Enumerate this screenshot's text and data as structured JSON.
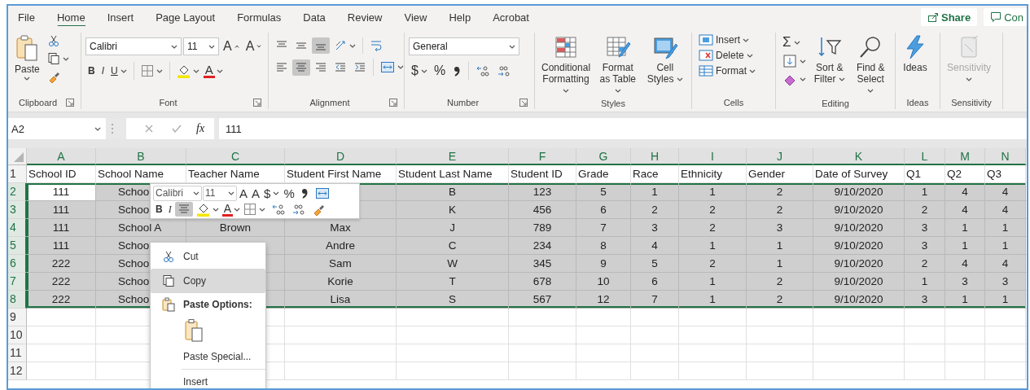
{
  "tabs": [
    {
      "label": "File",
      "selected": false
    },
    {
      "label": "Home",
      "selected": true
    },
    {
      "label": "Insert",
      "selected": false
    },
    {
      "label": "Page Layout",
      "selected": false
    },
    {
      "label": "Formulas",
      "selected": false
    },
    {
      "label": "Data",
      "selected": false
    },
    {
      "label": "Review",
      "selected": false
    },
    {
      "label": "View",
      "selected": false
    },
    {
      "label": "Help",
      "selected": false
    },
    {
      "label": "Acrobat",
      "selected": false
    }
  ],
  "share_button": "Share",
  "comments_button": "Con",
  "ribbon": {
    "clipboard": {
      "paste": "Paste",
      "label": "Clipboard"
    },
    "font": {
      "font_name": "Calibri",
      "font_size": "11",
      "grow": "A",
      "shrink": "A",
      "bold": "B",
      "italic": "I",
      "underline": "U",
      "font_color": "A",
      "label": "Font"
    },
    "alignment": {
      "buttons": [
        {
          "kind": "top",
          "selected": false
        },
        {
          "kind": "middle",
          "selected": false
        },
        {
          "kind": "bottom",
          "selected": true
        },
        {
          "kind": "left",
          "selected": false
        },
        {
          "kind": "center",
          "selected": true
        },
        {
          "kind": "right",
          "selected": false
        },
        {
          "kind": "outdent",
          "selected": false
        },
        {
          "kind": "indent",
          "selected": false
        }
      ],
      "label": "Alignment"
    },
    "number": {
      "format": "General",
      "currency": "$",
      "percent": "%",
      "label": "Number"
    },
    "styles": {
      "buttons": [
        "Conditional Formatting",
        "Format as Table",
        "Cell Styles"
      ],
      "label": "Styles"
    },
    "cells": {
      "buttons": [
        "Insert",
        "Delete",
        "Format"
      ],
      "label": "Cells"
    },
    "editing": {
      "autosum": "Σ",
      "buttons": [
        "Sort & Filter",
        "Find & Select"
      ],
      "label": "Editing"
    },
    "ideas": {
      "button": "Ideas",
      "label": "Ideas"
    },
    "sensitivity": {
      "button": "Sensitivity",
      "disabled": true,
      "label": "Sensitivity"
    }
  },
  "formula_bar": {
    "name_box": "A2",
    "function_label": "fx",
    "value": "111"
  },
  "sheet": {
    "columns": [
      {
        "letter": "A",
        "selected": true
      },
      {
        "letter": "B",
        "selected": true
      },
      {
        "letter": "C",
        "selected": true
      },
      {
        "letter": "D",
        "selected": true
      },
      {
        "letter": "E",
        "selected": true
      },
      {
        "letter": "F",
        "selected": true
      },
      {
        "letter": "G",
        "selected": true
      },
      {
        "letter": "H",
        "selected": true
      },
      {
        "letter": "I",
        "selected": true
      },
      {
        "letter": "J",
        "selected": true
      },
      {
        "letter": "K",
        "selected": true
      },
      {
        "letter": "L",
        "selected": true
      },
      {
        "letter": "M",
        "selected": true
      },
      {
        "letter": "N",
        "selected": true
      }
    ],
    "rows": [
      {
        "number": "1",
        "selected": false,
        "active": false,
        "cells": [
          "School ID",
          "School Name",
          "Teacher Name",
          "Student First Name",
          "Student Last Name",
          "Student ID",
          "Grade",
          "Race",
          "Ethnicity",
          "Gender",
          "Date of Survey",
          "Q1",
          "Q2",
          "Q3"
        ]
      },
      {
        "number": "2",
        "selected": true,
        "active": true,
        "cells": [
          "111",
          "Schoo",
          null,
          null,
          "B",
          "123",
          "5",
          "1",
          "1",
          "2",
          "9/10/2020",
          "1",
          "4",
          "4"
        ]
      },
      {
        "number": "3",
        "selected": true,
        "active": false,
        "cells": [
          "111",
          "Schoo",
          null,
          null,
          "K",
          "456",
          "6",
          "2",
          "2",
          "2",
          "9/10/2020",
          "2",
          "4",
          "4"
        ]
      },
      {
        "number": "4",
        "selected": true,
        "active": false,
        "cells": [
          "111",
          "School A",
          "Brown",
          "Max",
          "J",
          "789",
          "7",
          "3",
          "2",
          "3",
          "9/10/2020",
          "3",
          "1",
          "1"
        ]
      },
      {
        "number": "5",
        "selected": true,
        "active": false,
        "cells": [
          "111",
          "Schoo",
          null,
          "Andre",
          "C",
          "234",
          "8",
          "4",
          "1",
          "1",
          "9/10/2020",
          "3",
          "1",
          "1"
        ]
      },
      {
        "number": "6",
        "selected": true,
        "active": false,
        "cells": [
          "222",
          "Schoo",
          null,
          "Sam",
          "W",
          "345",
          "9",
          "5",
          "2",
          "1",
          "9/10/2020",
          "2",
          "4",
          "4"
        ]
      },
      {
        "number": "7",
        "selected": true,
        "active": false,
        "cells": [
          "222",
          "Schoo",
          null,
          "Korie",
          "T",
          "678",
          "10",
          "6",
          "1",
          "2",
          "9/10/2020",
          "1",
          "3",
          "3"
        ]
      },
      {
        "number": "8",
        "selected": true,
        "active": false,
        "cells": [
          "222",
          "Schoo",
          null,
          "Lisa",
          "S",
          "567",
          "12",
          "7",
          "1",
          "2",
          "9/10/2020",
          "3",
          "1",
          "1"
        ]
      },
      {
        "number": "9",
        "selected": false,
        "active": false
      },
      {
        "number": "10",
        "selected": false,
        "active": false
      },
      {
        "number": "11",
        "selected": false,
        "active": false
      },
      {
        "number": "12",
        "selected": false,
        "active": false
      }
    ]
  },
  "mini_toolbar": {
    "font_name": "Calibri",
    "font_size": "11",
    "grow": "A",
    "shrink": "A",
    "currency": "$",
    "percent": "%",
    "bold": "B",
    "italic": "I",
    "center_align": {
      "selected": true
    },
    "font_color": "A"
  },
  "context_menu": {
    "items": [
      {
        "kind": "command",
        "label": "Cut",
        "selected": false
      },
      {
        "kind": "command",
        "label": "Copy",
        "selected": true
      },
      {
        "kind": "heading",
        "label": "Paste Options:"
      },
      {
        "kind": "paste-option"
      },
      {
        "kind": "command",
        "label": "Paste Special...",
        "selected": false
      },
      {
        "kind": "command",
        "label": "Insert",
        "selected": false
      }
    ]
  }
}
